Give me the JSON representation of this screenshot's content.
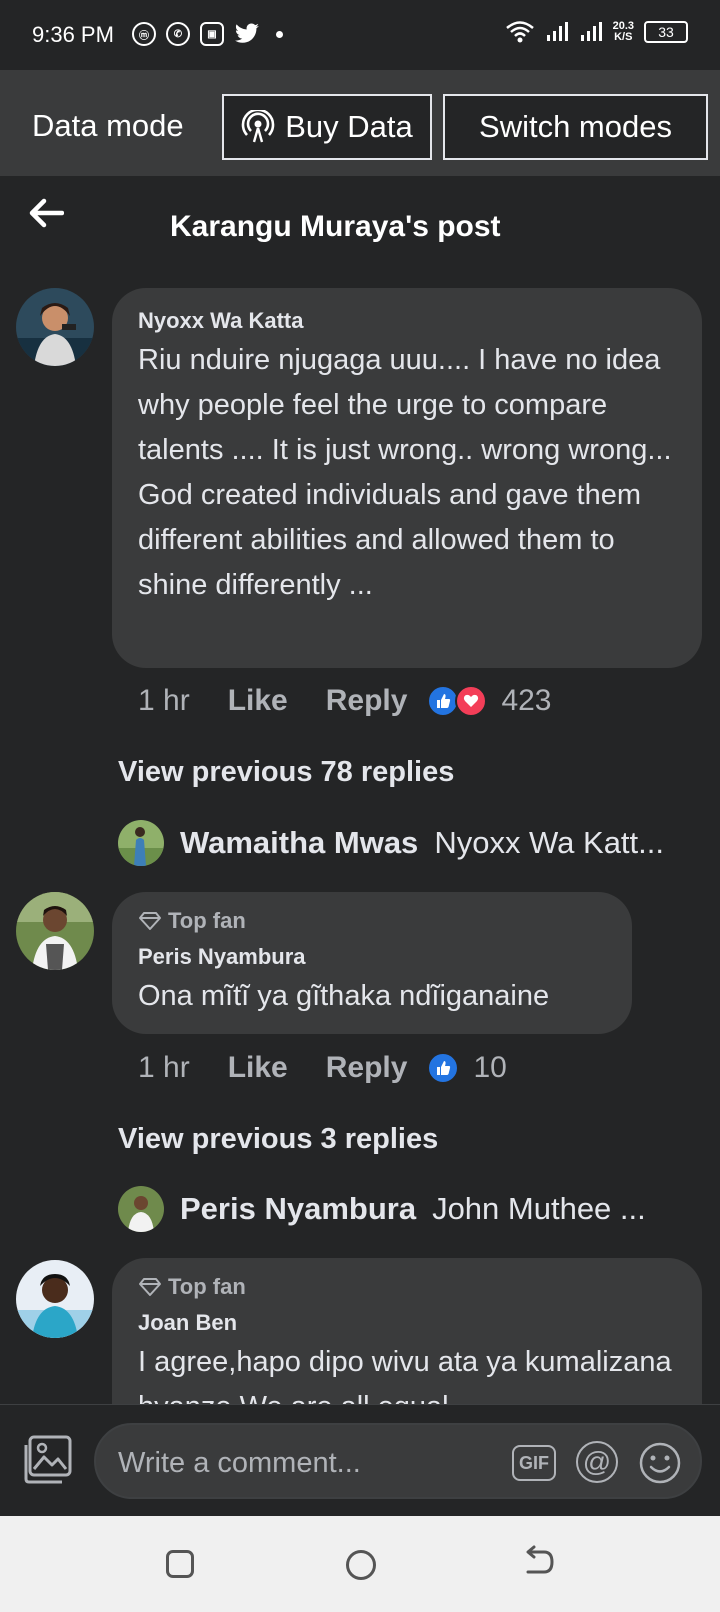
{
  "status_bar": {
    "time": "9:36 PM",
    "speed_top": "20.3",
    "speed_bottom": "K/S",
    "battery": "33"
  },
  "data_mode": {
    "label": "Data mode",
    "buy_label": "Buy Data",
    "switch_label": "Switch modes"
  },
  "header": {
    "title": "Karangu Muraya's post"
  },
  "comments": [
    {
      "author": "Nyoxx Wa Katta",
      "text": "Riu nduire njugaga uuu.... I have no idea why people feel the urge to compare talents .... It is just wrong.. wrong wrong... God created individuals and gave them different abilities and allowed them to shine differently ...",
      "time": "1 hr",
      "like": "Like",
      "reply": "Reply",
      "reaction_count": "423",
      "view_previous": "View previous 78 replies",
      "reply_preview": {
        "name": "Wamaitha Mwas",
        "text": "Nyoxx Wa Katt..."
      }
    },
    {
      "badge": "Top fan",
      "author": "Peris Nyambura",
      "text": "Ona mĩtĩ ya gĩthaka ndĩiganaine",
      "time": "1 hr",
      "like": "Like",
      "reply": "Reply",
      "reaction_count": "10",
      "view_previous": "View previous 3 replies",
      "reply_preview": {
        "name": "Peris Nyambura",
        "text": "John Muthee ..."
      }
    },
    {
      "badge": "Top fan",
      "author": "Joan Ben",
      "text": "I agree,hapo dipo wivu ata ya kumalizana hyanze We are all equal"
    }
  ],
  "composer": {
    "placeholder": "Write a comment...",
    "gif": "GIF",
    "at": "@"
  },
  "colors": {
    "background": "#242526",
    "bubble": "#3a3b3c",
    "like_blue": "#2374e1",
    "love_red": "#f33e58"
  }
}
